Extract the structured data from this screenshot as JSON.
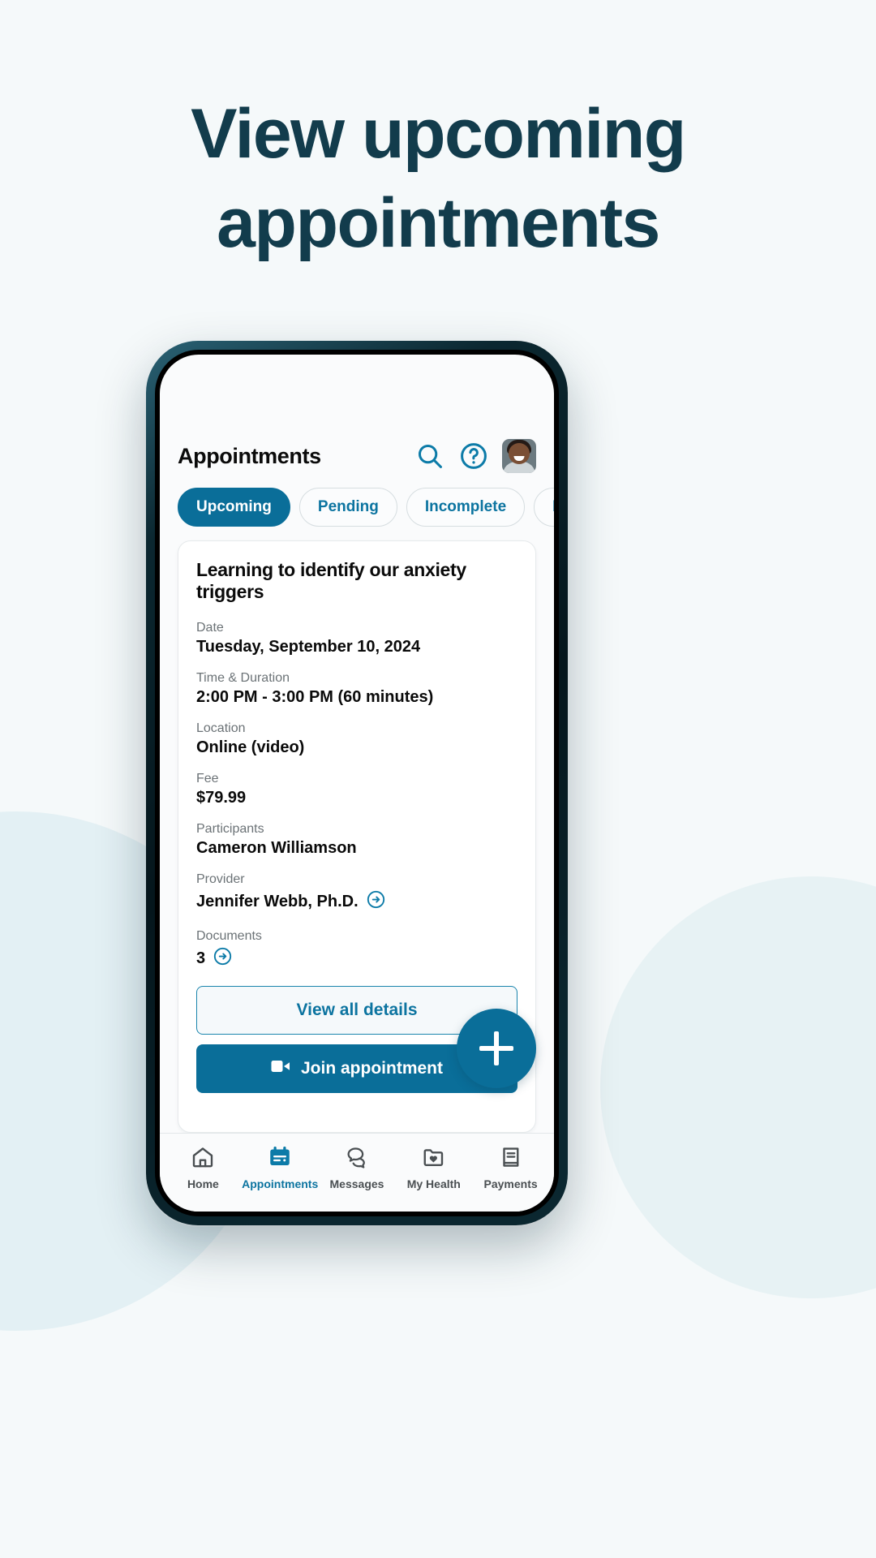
{
  "headline": {
    "line1": "View upcoming",
    "line2": "appointments",
    "color": "#123c4c"
  },
  "theme": {
    "accent": "#0a6e99",
    "accent_link": "#0c74a0",
    "page_background": "#f5f9fa",
    "text_primary": "#0a0a0a",
    "text_muted": "#6b7276"
  },
  "app": {
    "header": {
      "title": "Appointments",
      "icons": [
        "search-icon",
        "help-icon",
        "avatar"
      ]
    },
    "tabs": [
      {
        "label": "Upcoming",
        "active": true
      },
      {
        "label": "Pending",
        "active": false
      },
      {
        "label": "Incomplete",
        "active": false
      },
      {
        "label": "Past",
        "active": false
      }
    ],
    "appointment_card": {
      "title": "Learning to identify our anxiety triggers",
      "fields": [
        {
          "label": "Date",
          "value": "Tuesday, September 10, 2024",
          "arrow": false
        },
        {
          "label": "Time & Duration",
          "value": "2:00 PM - 3:00 PM (60 minutes)",
          "arrow": false
        },
        {
          "label": "Location",
          "value": "Online (video)",
          "arrow": false
        },
        {
          "label": "Fee",
          "value": "$79.99",
          "arrow": false
        },
        {
          "label": "Participants",
          "value": "Cameron Williamson",
          "arrow": false
        },
        {
          "label": "Provider",
          "value": "Jennifer Webb, Ph.D.",
          "arrow": true
        },
        {
          "label": "Documents",
          "value": "3",
          "arrow": true
        }
      ],
      "secondary_button": "View all details",
      "primary_button": "Join appointment",
      "primary_button_icon": "video-camera-icon"
    },
    "fab": {
      "icon": "plus-icon",
      "label": "+"
    },
    "bottom_nav": [
      {
        "label": "Home",
        "icon": "home-icon",
        "active": false
      },
      {
        "label": "Appointments",
        "icon": "calendar-icon",
        "active": true
      },
      {
        "label": "Messages",
        "icon": "chat-bubbles-icon",
        "active": false
      },
      {
        "label": "My Health",
        "icon": "folder-heart-icon",
        "active": false
      },
      {
        "label": "Payments",
        "icon": "book-icon",
        "active": false
      }
    ]
  }
}
